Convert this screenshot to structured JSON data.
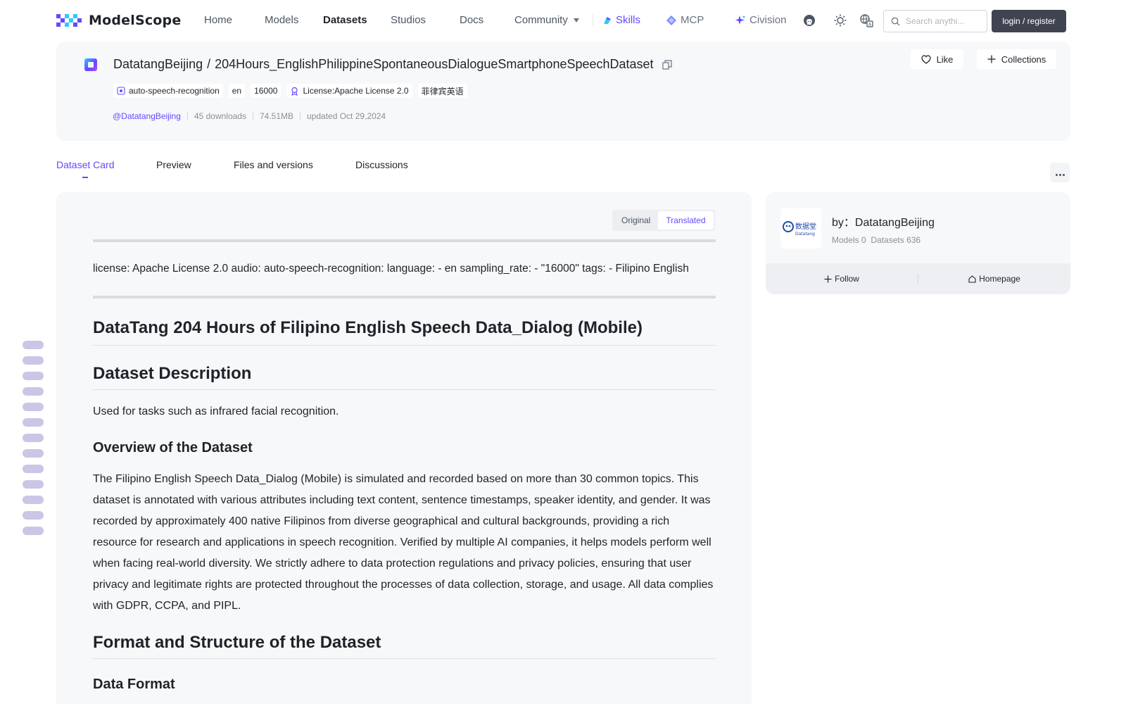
{
  "brand": {
    "name": "ModelScope",
    "accent": "#624aff"
  },
  "nav": {
    "links": [
      "Home",
      "Models",
      "Datasets",
      "Studios",
      "Docs",
      "Community"
    ],
    "active": "Datasets",
    "skills": "Skills",
    "mcp": "MCP",
    "civision": "Civision",
    "search_placeholder": "Search anythi...",
    "login": "login / register"
  },
  "dataset": {
    "owner": "DatatangBeijing",
    "separator": "/",
    "name": "204Hours_EnglishPhilippineSpontaneousDialogueSmartphoneSpeechDataset",
    "tags": [
      "auto-speech-recognition",
      "en",
      "16000",
      "License:Apache License 2.0",
      "菲律宾英语"
    ],
    "owner_handle": "@DatatangBeijing",
    "downloads": "45 downloads",
    "size": "74.51MB",
    "updated": "updated Oct 29,2024",
    "like": "Like",
    "collections": "Collections"
  },
  "tabs": [
    "Dataset Card",
    "Preview",
    "Files and versions",
    "Discussions"
  ],
  "active_tab": "Dataset Card",
  "card": {
    "toggle": [
      "Original",
      "Translated"
    ],
    "toggle_active": "Translated",
    "frontmatter": "license: Apache License 2.0 audio: auto-speech-recognition: language: - en sampling_rate: - \"16000\" tags: - Filipino English",
    "title": "DataTang 204 Hours of Filipino English Speech Data_Dialog (Mobile)",
    "description_heading": "Dataset Description",
    "description_text": "Used for tasks such as infrared facial recognition.",
    "overview_heading": "Overview of the Dataset",
    "overview_text": "The Filipino English Speech Data_Dialog (Mobile) is simulated and recorded based on more than 30 common topics. This dataset is annotated with various attributes including text content, sentence timestamps, speaker identity, and gender. It was recorded by approximately 400 native Filipinos from diverse geographical and cultural backgrounds, providing a rich resource for research and applications in speech recognition. Verified by multiple AI companies, it helps models perform well when facing real-world diversity. We strictly adhere to data protection regulations and privacy policies, ensuring that user privacy and legitimate rights are protected throughout the processes of data collection, storage, and usage. All data complies with GDPR, CCPA, and PIPL.",
    "format_heading": "Format and Structure of the Dataset",
    "data_format_heading": "Data Format"
  },
  "author": {
    "by": "by：DatatangBeijing",
    "models": "Models 0",
    "datasets": "Datasets 636",
    "follow": "Follow",
    "homepage": "Homepage",
    "logo_text": "数据堂",
    "logo_sub": "Datatang"
  }
}
